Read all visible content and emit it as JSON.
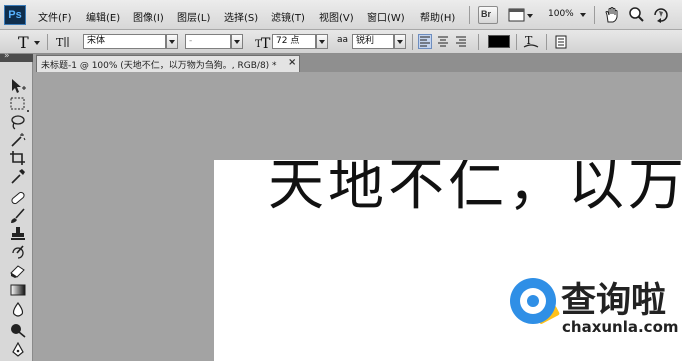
{
  "app": {
    "logo": "Ps"
  },
  "menubar": {
    "items": [
      {
        "label": "文件(F)"
      },
      {
        "label": "编辑(E)"
      },
      {
        "label": "图像(I)"
      },
      {
        "label": "图层(L)"
      },
      {
        "label": "选择(S)"
      },
      {
        "label": "滤镜(T)"
      },
      {
        "label": "视图(V)"
      },
      {
        "label": "窗口(W)"
      },
      {
        "label": "帮助(H)"
      }
    ],
    "bridge_label": "Br",
    "zoom": "100%"
  },
  "options": {
    "font_family": "宋体",
    "font_style": "-",
    "font_size": "72 点",
    "aa_label": "aa",
    "anti_alias": "锐利"
  },
  "document": {
    "tab_title": "未标题-1 @ 100% (天地不仁，以万物为刍狗。, RGB/8) *",
    "close": "×",
    "canvas_text": "天地不仁，以万物"
  },
  "watermark": {
    "title": "查询啦",
    "url": "chaxunla.com",
    "colors": {
      "blue": "#2f8fe6",
      "yellow": "#ffc11a"
    }
  },
  "colors": {
    "text_color": "#000000"
  }
}
